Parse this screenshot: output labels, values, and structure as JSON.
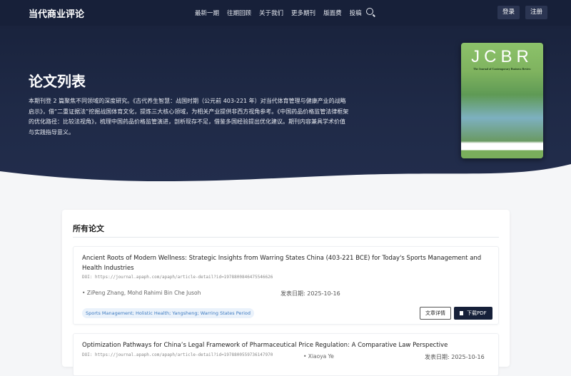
{
  "nav": {
    "logo": "当代商业评论",
    "menu": [
      "最新一期",
      "往期回顾",
      "关于我们",
      "更多期刊",
      "版面费",
      "投稿"
    ],
    "login": "登录",
    "register": "注册"
  },
  "hero": {
    "title": "论文列表",
    "description": "本期刊登 2 篇聚焦不同领域的深度研究。《古代养生智慧：战国时期（公元前 403-221 年）对当代体育管理与健康产业的战略启示》，借“二重证据法”挖掘战国体育文化，提炼三大核心领域，为相关产业提供非西方视角参考。《中国药品价格监管法律框架的优化路径：比较法视角》，梳理中国药品价格监管演进，剖析现存不足，借鉴多国经验提出优化建议。期刊内容兼具学术价值与实践指导意义。",
    "cover": {
      "logo": "JCBR",
      "subtitle": "The Journal of Contemporary Business Review"
    }
  },
  "list": {
    "heading": "所有论文",
    "detail_label": "文章详情",
    "pdf_label": "下载PDF",
    "articles": [
      {
        "title": "Ancient Roots of Modern Wellness: Strategic Insights from Warring States China (403-221 BCE) for Today's Sports Management and Health Industries",
        "doi": "DOI: https://journal.apaph.com/apaph/article-detail?id=1978800846475546626",
        "authors": "• ZiPeng Zhang, Mohd Rahimi Bin Che Jusoh",
        "date": "发表日期: 2025-10-16",
        "tags": "Sports Management; Holistic Health; Yangsheng; Warring States Period"
      },
      {
        "title": "Optimization Pathways for China’s Legal Framework of Pharmaceutical Price Regulation: A Comparative Law Perspective",
        "doi": "DOI: https://journal.apaph.com/apaph/article-detail?id=1978800559736147970",
        "authors": "• Xiaoya Ye",
        "date": "发表日期: 2025-10-16"
      }
    ]
  }
}
